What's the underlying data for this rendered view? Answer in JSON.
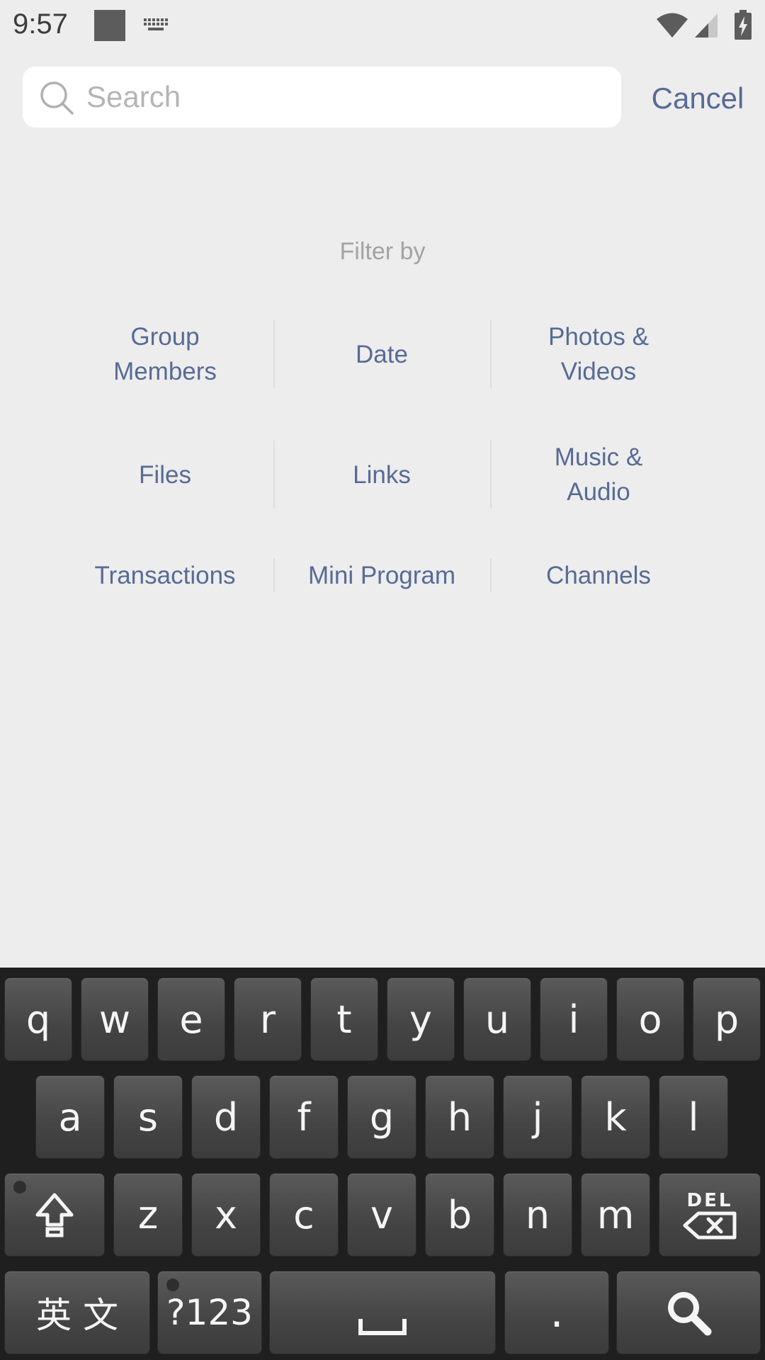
{
  "status_bar": {
    "time": "9:57"
  },
  "search": {
    "placeholder": "Search",
    "value": "",
    "cancel_label": "Cancel"
  },
  "filter": {
    "title": "Filter by",
    "rows": [
      [
        "Group Members",
        "Date",
        "Photos & Videos"
      ],
      [
        "Files",
        "Links",
        "Music & Audio"
      ],
      [
        "Transactions",
        "Mini Program",
        "Channels"
      ]
    ]
  },
  "keyboard": {
    "row1": [
      "q",
      "w",
      "e",
      "r",
      "t",
      "y",
      "u",
      "i",
      "o",
      "p"
    ],
    "row2": [
      "a",
      "s",
      "d",
      "f",
      "g",
      "h",
      "j",
      "k",
      "l"
    ],
    "row3": [
      "z",
      "x",
      "c",
      "v",
      "b",
      "n",
      "m"
    ],
    "language_label": "英 文",
    "symbols_label": "?123",
    "period_label": ".",
    "delete_label": "DEL"
  },
  "colors": {
    "accent": "#576b95",
    "caret": "#1aad19",
    "background": "#ededed"
  }
}
